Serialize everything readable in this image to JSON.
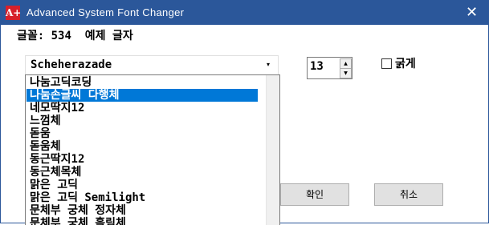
{
  "window": {
    "title": "Advanced System Font Changer",
    "icon_label": "A+",
    "close_glyph": "✕"
  },
  "status": {
    "text": "글꼴: 534  예제 글자"
  },
  "font_select": {
    "value": "Scheherazade",
    "arrow": "▾"
  },
  "size": {
    "value": "13",
    "up": "▲",
    "down": "▼"
  },
  "bold": {
    "label": "굵게",
    "checked": false
  },
  "font_list": {
    "items": [
      {
        "label": "나눔고딕코딩"
      },
      {
        "label": "나눔손글씨 다행체",
        "selected": true
      },
      {
        "label": "네모딱지12"
      },
      {
        "label": "느껌체"
      },
      {
        "label": "돋움"
      },
      {
        "label": "돋움체"
      },
      {
        "label": "동근딱지12"
      },
      {
        "label": "동근체목체"
      },
      {
        "label": "맑은 고딕"
      },
      {
        "label": "맑은 고딕 Semilight"
      },
      {
        "label": "문체부 궁체 정자체"
      },
      {
        "label": "문체부 궁체 흘림체"
      }
    ]
  },
  "buttons": {
    "ok_label": "확인",
    "cancel_label": "취소"
  },
  "colors": {
    "titlebar": "#2b579a",
    "selection": "#0078d7",
    "icon": "#d6202a"
  }
}
